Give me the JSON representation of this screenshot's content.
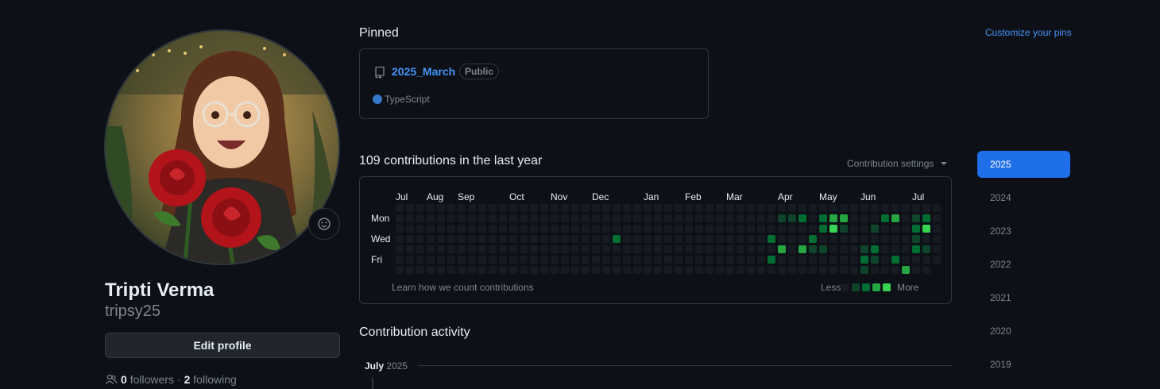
{
  "profile": {
    "fullname": "Tripti Verma",
    "username": "tripsy25",
    "edit_label": "Edit profile",
    "followers_count": "0",
    "followers_label": "followers",
    "separator": "·",
    "following_count": "2",
    "following_label": "following"
  },
  "pinned": {
    "heading": "Pinned",
    "customize_label": "Customize your pins",
    "repo": {
      "name": "2025_March",
      "visibility": "Public",
      "language": "TypeScript",
      "language_color": "#3178c6"
    }
  },
  "contributions": {
    "heading": "109 contributions in the last year",
    "settings_label": "Contribution settings",
    "months": [
      "Jul",
      "Aug",
      "Sep",
      "Oct",
      "Nov",
      "Dec",
      "Jan",
      "Feb",
      "Mar",
      "Apr",
      "May",
      "Jun",
      "Jul"
    ],
    "day_labels": [
      "Mon",
      "Wed",
      "Fri"
    ],
    "learn_label": "Learn how we count contributions",
    "less_label": "Less",
    "more_label": "More",
    "level_colors": [
      "#161b22",
      "#0e4429",
      "#006d32",
      "#26a641",
      "#39d353"
    ],
    "cells": [
      {
        "week": 21,
        "day": 3,
        "level": 2
      },
      {
        "week": 36,
        "day": 3,
        "level": 2
      },
      {
        "week": 36,
        "day": 5,
        "level": 2
      },
      {
        "week": 37,
        "day": 1,
        "level": 1
      },
      {
        "week": 37,
        "day": 4,
        "level": 3
      },
      {
        "week": 38,
        "day": 1,
        "level": 1
      },
      {
        "week": 39,
        "day": 1,
        "level": 2
      },
      {
        "week": 39,
        "day": 4,
        "level": 3
      },
      {
        "week": 40,
        "day": 3,
        "level": 2
      },
      {
        "week": 40,
        "day": 4,
        "level": 1
      },
      {
        "week": 41,
        "day": 1,
        "level": 2
      },
      {
        "week": 41,
        "day": 2,
        "level": 2
      },
      {
        "week": 41,
        "day": 4,
        "level": 1
      },
      {
        "week": 42,
        "day": 1,
        "level": 3
      },
      {
        "week": 42,
        "day": 2,
        "level": 4
      },
      {
        "week": 43,
        "day": 1,
        "level": 3
      },
      {
        "week": 43,
        "day": 2,
        "level": 1
      },
      {
        "week": 45,
        "day": 4,
        "level": 1
      },
      {
        "week": 45,
        "day": 5,
        "level": 2
      },
      {
        "week": 45,
        "day": 6,
        "level": 1
      },
      {
        "week": 46,
        "day": 2,
        "level": 1
      },
      {
        "week": 46,
        "day": 4,
        "level": 2
      },
      {
        "week": 46,
        "day": 5,
        "level": 1
      },
      {
        "week": 47,
        "day": 1,
        "level": 2
      },
      {
        "week": 48,
        "day": 1,
        "level": 3
      },
      {
        "week": 48,
        "day": 5,
        "level": 2
      },
      {
        "week": 49,
        "day": 6,
        "level": 3
      },
      {
        "week": 50,
        "day": 1,
        "level": 1
      },
      {
        "week": 50,
        "day": 2,
        "level": 2
      },
      {
        "week": 50,
        "day": 3,
        "level": 1
      },
      {
        "week": 50,
        "day": 4,
        "level": 2
      },
      {
        "week": 51,
        "day": 1,
        "level": 2
      },
      {
        "week": 51,
        "day": 2,
        "level": 4
      },
      {
        "week": 51,
        "day": 4,
        "level": 1
      }
    ]
  },
  "years": [
    "2025",
    "2024",
    "2023",
    "2022",
    "2021",
    "2020",
    "2019"
  ],
  "active_year": "2025",
  "activity": {
    "heading": "Contribution activity",
    "month": "July",
    "year": "2025"
  }
}
